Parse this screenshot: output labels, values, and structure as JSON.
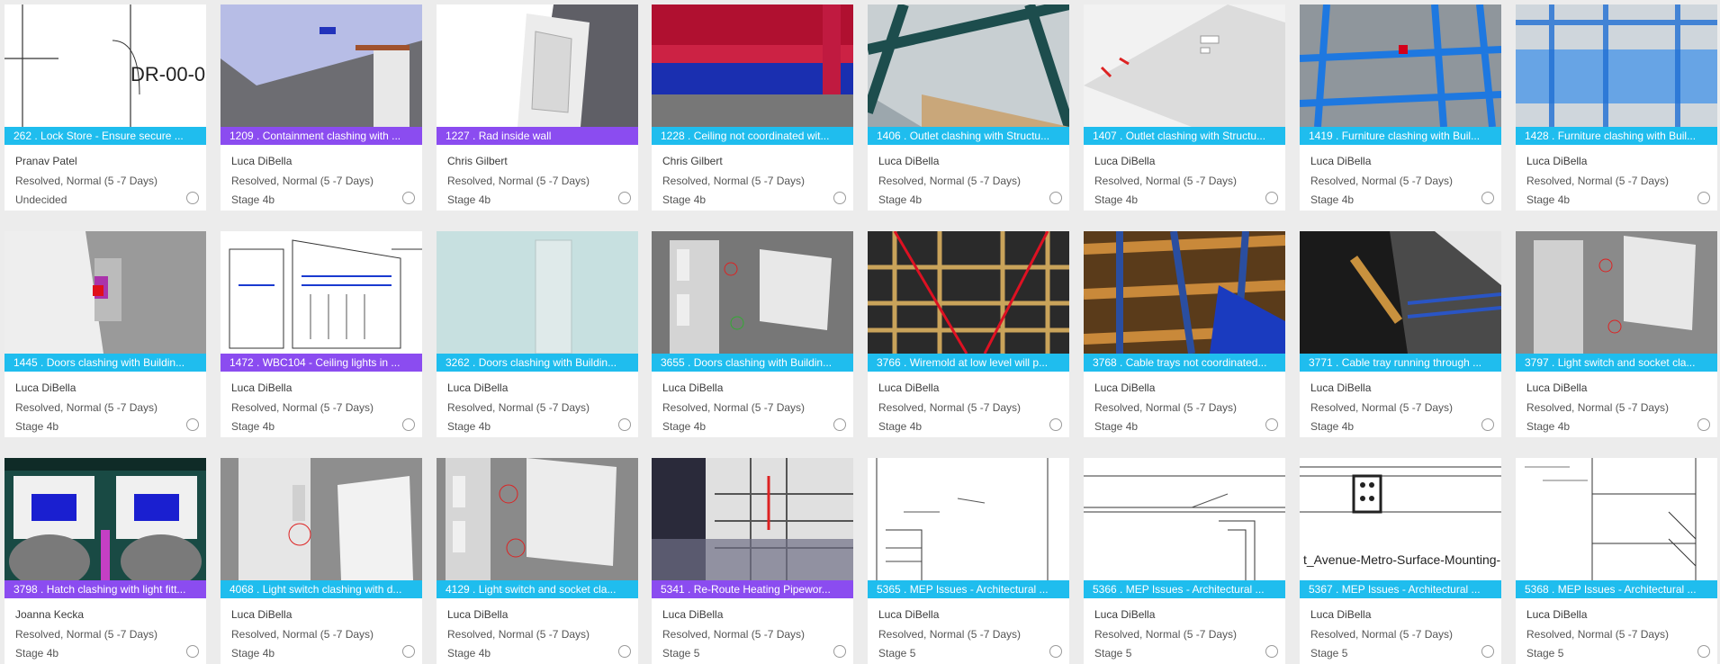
{
  "cards": [
    {
      "title": "262 . Lock Store - Ensure secure ...",
      "assignee": "Pranav Patel",
      "status": "Resolved, Normal (5 -7 Days)",
      "stage": "Undecided",
      "color": "cyan",
      "thumb_text": "DR-00-0"
    },
    {
      "title": "1209 . Containment clashing with ...",
      "assignee": "Luca DiBella",
      "status": "Resolved, Normal (5 -7 Days)",
      "stage": "Stage 4b",
      "color": "purple"
    },
    {
      "title": "1227 . Rad inside wall",
      "assignee": "Chris Gilbert",
      "status": "Resolved, Normal (5 -7 Days)",
      "stage": "Stage 4b",
      "color": "purple"
    },
    {
      "title": "1228 . Ceiling not coordinated wit...",
      "assignee": "Chris Gilbert",
      "status": "Resolved, Normal (5 -7 Days)",
      "stage": "Stage 4b",
      "color": "cyan"
    },
    {
      "title": "1406 . Outlet clashing with Structu...",
      "assignee": "Luca DiBella",
      "status": "Resolved, Normal (5 -7 Days)",
      "stage": "Stage 4b",
      "color": "cyan"
    },
    {
      "title": "1407 . Outlet clashing with Structu...",
      "assignee": "Luca DiBella",
      "status": "Resolved, Normal (5 -7 Days)",
      "stage": "Stage 4b",
      "color": "cyan"
    },
    {
      "title": "1419 . Furniture clashing with Buil...",
      "assignee": "Luca DiBella",
      "status": "Resolved, Normal (5 -7 Days)",
      "stage": "Stage 4b",
      "color": "cyan"
    },
    {
      "title": "1428 . Furniture clashing with Buil...",
      "assignee": "Luca DiBella",
      "status": "Resolved, Normal (5 -7 Days)",
      "stage": "Stage 4b",
      "color": "cyan"
    },
    {
      "title": "1445 . Doors clashing with Buildin...",
      "assignee": "Luca DiBella",
      "status": "Resolved, Normal (5 -7 Days)",
      "stage": "Stage 4b",
      "color": "cyan"
    },
    {
      "title": "1472 . WBC104 - Ceiling lights in ...",
      "assignee": "Luca DiBella",
      "status": "Resolved, Normal (5 -7 Days)",
      "stage": "Stage 4b",
      "color": "purple"
    },
    {
      "title": "3262 . Doors clashing with Buildin...",
      "assignee": "Luca DiBella",
      "status": "Resolved, Normal (5 -7 Days)",
      "stage": "Stage 4b",
      "color": "cyan"
    },
    {
      "title": "3655 . Doors clashing with Buildin...",
      "assignee": "Luca DiBella",
      "status": "Resolved, Normal (5 -7 Days)",
      "stage": "Stage 4b",
      "color": "cyan"
    },
    {
      "title": "3766 . Wiremold at low level will p...",
      "assignee": "Luca DiBella",
      "status": "Resolved, Normal (5 -7 Days)",
      "stage": "Stage 4b",
      "color": "cyan"
    },
    {
      "title": "3768 . Cable trays not coordinated...",
      "assignee": "Luca DiBella",
      "status": "Resolved, Normal (5 -7 Days)",
      "stage": "Stage 4b",
      "color": "cyan"
    },
    {
      "title": "3771 . Cable tray running through ...",
      "assignee": "Luca DiBella",
      "status": "Resolved, Normal (5 -7 Days)",
      "stage": "Stage 4b",
      "color": "cyan"
    },
    {
      "title": "3797 . Light switch and socket cla...",
      "assignee": "Luca DiBella",
      "status": "Resolved, Normal (5 -7 Days)",
      "stage": "Stage 4b",
      "color": "cyan"
    },
    {
      "title": "3798 . Hatch clashing with light fitt...",
      "assignee": "Joanna Kecka",
      "status": "Resolved, Normal (5 -7 Days)",
      "stage": "Stage 4b",
      "color": "purple"
    },
    {
      "title": "4068 . Light switch clashing with d...",
      "assignee": "Luca DiBella",
      "status": "Resolved, Normal (5 -7 Days)",
      "stage": "Stage 4b",
      "color": "cyan"
    },
    {
      "title": "4129 . Light switch and socket cla...",
      "assignee": "Luca DiBella",
      "status": "Resolved, Normal (5 -7 Days)",
      "stage": "Stage 4b",
      "color": "cyan"
    },
    {
      "title": "5341 . Re-Route Heating Pipewor...",
      "assignee": "Luca DiBella",
      "status": "Resolved, Normal (5 -7 Days)",
      "stage": "Stage 5",
      "color": "purple"
    },
    {
      "title": "5365 . MEP Issues - Architectural ...",
      "assignee": "Luca DiBella",
      "status": "Resolved, Normal (5 -7 Days)",
      "stage": "Stage 5",
      "color": "cyan"
    },
    {
      "title": "5366 . MEP Issues - Architectural ...",
      "assignee": "Luca DiBella",
      "status": "Resolved, Normal (5 -7 Days)",
      "stage": "Stage 5",
      "color": "cyan"
    },
    {
      "title": "5367 . MEP Issues - Architectural ...",
      "assignee": "Luca DiBella",
      "status": "Resolved, Normal (5 -7 Days)",
      "stage": "Stage 5",
      "color": "cyan",
      "thumb_text": "t_Avenue-Metro-Surface-Mounting-l"
    },
    {
      "title": "5368 . MEP Issues - Architectural ...",
      "assignee": "Luca DiBella",
      "status": "Resolved, Normal (5 -7 Days)",
      "stage": "Stage 5",
      "color": "cyan"
    }
  ],
  "colors": {
    "cyan": "#1fbdee",
    "purple": "#8b4cf0",
    "background": "#ececec"
  }
}
